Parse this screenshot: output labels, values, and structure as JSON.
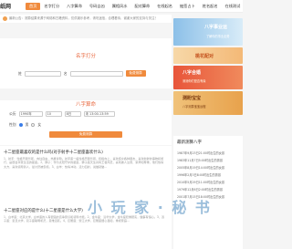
{
  "header": {
    "logo": "纸网",
    "nav": [
      "首页",
      "名字打分",
      "八字算命",
      "号码吉凶",
      "属相风水",
      "配对算命",
      "在线起名",
      "抽签占卜",
      "姓名起名",
      "在线测试"
    ],
    "active_index": 0
  },
  "notice": "最新公告：测算结果来源于网络和古籍资料，仅供娱乐参考，请勿迷信，合理看待，谢谢大家的支持与关注！",
  "name_score": {
    "title": "名字打分",
    "surname_label": "姓",
    "given_label": "名",
    "button": "免费测算"
  },
  "bazi": {
    "title": "八字算命",
    "date_label": "公历",
    "year": "1990年",
    "month": "10",
    "day": "8日",
    "hour": "未 13:00-13:59",
    "gender_label": "性别",
    "male": "男",
    "female": "女",
    "button": "免费测算"
  },
  "articles": [
    {
      "title": "十二星座最喜欢的是什么吗(对于射手十二星座喜欢什么)",
      "text": "1、射手：性格开朗乐观，向往自由，热爱冒险。射手座一般性格开朗乐观，积极向上，喜欢结交各种朋友，喜欢新鲜的事物和旅行，是很会享受生活的星座。2、狮子：作为太阳守护的星座，狮子座天生具有王者风范，喜欢被人注意、崇拜和尊重，他们热情大方，喜欢领导别人，最讨厌被忽视。3、白羊：热情冲动，活力四射，说做就做..."
    },
    {
      "title": "十二星座对应的是什么(十二星座是什么大学)",
      "text": "1、白羊座：北京大学，白羊座的人有很强的竞争意识和领导才能。2、金牛座：清华大学，金牛座稳重踏实，做事有恒心。3、双子座：复旦大学，双子座聪明机灵，思维活跃。4、巨蟹座：浙江大学，巨蟹座细心温和，重视家庭..."
    }
  ],
  "banners": [
    {
      "title": "八字事业运",
      "sub": "了解你的事业走势"
    },
    {
      "title": "桃花配对",
      "sub": ""
    },
    {
      "title": "八字合婚",
      "sub": "测测你们是否有缘"
    },
    {
      "title": "测盼宝宝",
      "sub": "八字测算宝宝运程"
    }
  ],
  "recent": {
    "title": "最新测算八字",
    "items": [
      "1987年9月23日21:00时出生的女孩",
      "1983年11月7日5:00时出生的男孩",
      "2005年8月19日14:00时出生的女孩",
      "1996年2月3日8:00时出生的男孩",
      "2010年5月29日11:00时出生的女孩",
      "1979年12月6日2:00时出生的男孩",
      "2001年7月15日18:00时出生的女孩"
    ]
  },
  "watermark": "小 玩 家 · 秘 书"
}
